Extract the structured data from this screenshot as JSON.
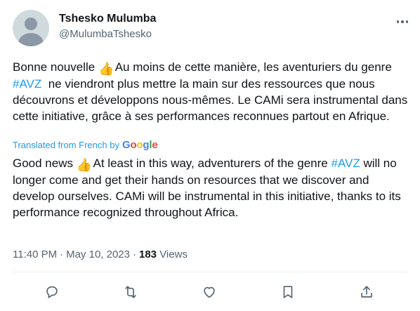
{
  "author": {
    "display_name": "Tshesko Mulumba",
    "handle": "@MulumbaTshesko"
  },
  "icons": {
    "more": "more-icon",
    "reply": "reply-icon",
    "retweet": "retweet-icon",
    "like": "like-icon",
    "bookmark": "bookmark-icon",
    "share": "share-icon",
    "thumbs_up": "thumbs-up-emoji"
  },
  "original": {
    "part1": "Bonne nouvelle ",
    "part2": " Au moins de cette manière, les aventuriers du genre ",
    "hashtag": "#AVZ",
    "part3": "  ne viendront plus mettre la main sur des ressources que nous découvrons et développons nous-mêmes. Le CAMi sera instrumental dans cette initiative, grâce à ses performances reconnues partout en Afrique."
  },
  "translation_label": "Translated from French by",
  "google": {
    "g": "G",
    "o1": "o",
    "o2": "o",
    "g2": "g",
    "l": "l",
    "e": "e"
  },
  "translated": {
    "part1": "Good news ",
    "part2": " At least in this way, adventurers of the genre ",
    "hashtag": "#AVZ",
    "part3": " will no longer come and get their hands on resources that we discover and develop ourselves. CAMi will be instrumental in this initiative, thanks to its performance recognized throughout Africa."
  },
  "meta": {
    "time": "11:40 PM",
    "separator": "·",
    "date": "May 10, 2023",
    "views_count": "183",
    "views_label": "Views"
  },
  "colors": {
    "link": "#1d9bf0",
    "secondary_text": "#536471",
    "primary_text": "#0f1419"
  }
}
